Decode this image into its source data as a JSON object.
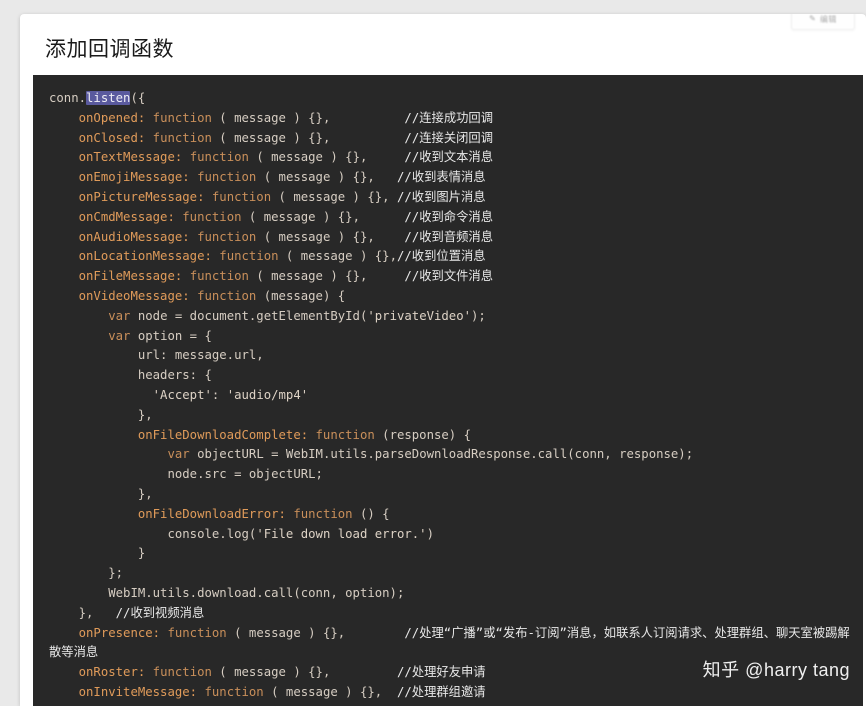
{
  "window": {
    "background_color": "#e9e9e9",
    "card_color": "#ffffff"
  },
  "header": {
    "title": "添加回调函数",
    "top_right_control": {
      "icon": "pencil-icon",
      "label": "编辑"
    }
  },
  "code_block": {
    "background_color": "#282828",
    "language": "javascript",
    "selection": {
      "text": "listen",
      "color": "#5a5a9e"
    },
    "lines": [
      {
        "indent": 0,
        "tokens": [
          {
            "t": "conn.",
            "c": "t-plain"
          },
          {
            "t": "listen",
            "c": "sel"
          },
          {
            "t": "({",
            "c": "t-punct"
          }
        ]
      },
      {
        "indent": 1,
        "tokens": [
          {
            "t": "onOpened: ",
            "c": "t-prop"
          },
          {
            "t": "function",
            "c": "t-kw"
          },
          {
            "t": " ( message ) {},",
            "c": "t-plain"
          },
          {
            "t": "          ",
            "c": "t-plain"
          },
          {
            "t": "//连接成功回调",
            "c": "t-cmt"
          }
        ]
      },
      {
        "indent": 1,
        "tokens": [
          {
            "t": "onClosed: ",
            "c": "t-prop"
          },
          {
            "t": "function",
            "c": "t-kw"
          },
          {
            "t": " ( message ) {},",
            "c": "t-plain"
          },
          {
            "t": "          ",
            "c": "t-plain"
          },
          {
            "t": "//连接关闭回调",
            "c": "t-cmt"
          }
        ]
      },
      {
        "indent": 1,
        "tokens": [
          {
            "t": "onTextMessage: ",
            "c": "t-prop"
          },
          {
            "t": "function",
            "c": "t-kw"
          },
          {
            "t": " ( message ) {},",
            "c": "t-plain"
          },
          {
            "t": "     ",
            "c": "t-plain"
          },
          {
            "t": "//收到文本消息",
            "c": "t-cmt"
          }
        ]
      },
      {
        "indent": 1,
        "tokens": [
          {
            "t": "onEmojiMessage: ",
            "c": "t-prop"
          },
          {
            "t": "function",
            "c": "t-kw"
          },
          {
            "t": " ( message ) {},",
            "c": "t-plain"
          },
          {
            "t": "   ",
            "c": "t-plain"
          },
          {
            "t": "//收到表情消息",
            "c": "t-cmt"
          }
        ]
      },
      {
        "indent": 1,
        "tokens": [
          {
            "t": "onPictureMessage: ",
            "c": "t-prop"
          },
          {
            "t": "function",
            "c": "t-kw"
          },
          {
            "t": " ( message ) {}, ",
            "c": "t-plain"
          },
          {
            "t": "//收到图片消息",
            "c": "t-cmt"
          }
        ]
      },
      {
        "indent": 1,
        "tokens": [
          {
            "t": "onCmdMessage: ",
            "c": "t-prop"
          },
          {
            "t": "function",
            "c": "t-kw"
          },
          {
            "t": " ( message ) {},",
            "c": "t-plain"
          },
          {
            "t": "      ",
            "c": "t-plain"
          },
          {
            "t": "//收到命令消息",
            "c": "t-cmt"
          }
        ]
      },
      {
        "indent": 1,
        "tokens": [
          {
            "t": "onAudioMessage: ",
            "c": "t-prop"
          },
          {
            "t": "function",
            "c": "t-kw"
          },
          {
            "t": " ( message ) {},",
            "c": "t-plain"
          },
          {
            "t": "    ",
            "c": "t-plain"
          },
          {
            "t": "//收到音频消息",
            "c": "t-cmt"
          }
        ]
      },
      {
        "indent": 1,
        "tokens": [
          {
            "t": "onLocationMessage: ",
            "c": "t-prop"
          },
          {
            "t": "function",
            "c": "t-kw"
          },
          {
            "t": " ( message ) {},",
            "c": "t-plain"
          },
          {
            "t": "//收到位置消息",
            "c": "t-cmt"
          }
        ]
      },
      {
        "indent": 1,
        "tokens": [
          {
            "t": "onFileMessage: ",
            "c": "t-prop"
          },
          {
            "t": "function",
            "c": "t-kw"
          },
          {
            "t": " ( message ) {},",
            "c": "t-plain"
          },
          {
            "t": "     ",
            "c": "t-plain"
          },
          {
            "t": "//收到文件消息",
            "c": "t-cmt"
          }
        ]
      },
      {
        "indent": 1,
        "tokens": [
          {
            "t": "onVideoMessage: ",
            "c": "t-prop"
          },
          {
            "t": "function",
            "c": "t-kw"
          },
          {
            "t": " (message) {",
            "c": "t-plain"
          }
        ]
      },
      {
        "indent": 2,
        "tokens": [
          {
            "t": "var",
            "c": "t-kw"
          },
          {
            "t": " node = document.getElementById(",
            "c": "t-plain"
          },
          {
            "t": "'privateVideo'",
            "c": "t-str"
          },
          {
            "t": ");",
            "c": "t-plain"
          }
        ]
      },
      {
        "indent": 2,
        "tokens": [
          {
            "t": "var",
            "c": "t-kw"
          },
          {
            "t": " option = {",
            "c": "t-plain"
          }
        ]
      },
      {
        "indent": 3,
        "tokens": [
          {
            "t": "url: message.url,",
            "c": "t-plain"
          }
        ]
      },
      {
        "indent": 3,
        "tokens": [
          {
            "t": "headers: {",
            "c": "t-plain"
          }
        ]
      },
      {
        "indent": 3,
        "extra": 2,
        "tokens": [
          {
            "t": "'Accept'",
            "c": "t-str"
          },
          {
            "t": ": ",
            "c": "t-plain"
          },
          {
            "t": "'audio/mp4'",
            "c": "t-str"
          }
        ]
      },
      {
        "indent": 3,
        "tokens": [
          {
            "t": "},",
            "c": "t-plain"
          }
        ]
      },
      {
        "indent": 3,
        "tokens": [
          {
            "t": "onFileDownloadComplete: ",
            "c": "t-prop"
          },
          {
            "t": "function",
            "c": "t-kw"
          },
          {
            "t": " (response) {",
            "c": "t-plain"
          }
        ]
      },
      {
        "indent": 4,
        "tokens": [
          {
            "t": "var",
            "c": "t-kw"
          },
          {
            "t": " objectURL = WebIM.utils.parseDownloadResponse.call(conn, response);",
            "c": "t-plain"
          }
        ]
      },
      {
        "indent": 4,
        "tokens": [
          {
            "t": "node.src = objectURL;",
            "c": "t-plain"
          }
        ]
      },
      {
        "indent": 3,
        "tokens": [
          {
            "t": "},",
            "c": "t-plain"
          }
        ]
      },
      {
        "indent": 3,
        "tokens": [
          {
            "t": "onFileDownloadError: ",
            "c": "t-prop"
          },
          {
            "t": "function",
            "c": "t-kw"
          },
          {
            "t": " () {",
            "c": "t-plain"
          }
        ]
      },
      {
        "indent": 4,
        "tokens": [
          {
            "t": "console.log(",
            "c": "t-plain"
          },
          {
            "t": "'File down load error.'",
            "c": "t-str"
          },
          {
            "t": ")",
            "c": "t-plain"
          }
        ]
      },
      {
        "indent": 3,
        "tokens": [
          {
            "t": "}",
            "c": "t-plain"
          }
        ]
      },
      {
        "indent": 2,
        "tokens": [
          {
            "t": "};",
            "c": "t-plain"
          }
        ]
      },
      {
        "indent": 2,
        "tokens": [
          {
            "t": "WebIM.utils.download.call(conn, option);",
            "c": "t-plain"
          }
        ]
      },
      {
        "indent": 1,
        "tokens": [
          {
            "t": "},   ",
            "c": "t-plain"
          },
          {
            "t": "//收到视频消息",
            "c": "t-cmt"
          }
        ]
      },
      {
        "indent": 1,
        "tokens": [
          {
            "t": "onPresence: ",
            "c": "t-prop"
          },
          {
            "t": "function",
            "c": "t-kw"
          },
          {
            "t": " ( message ) {},",
            "c": "t-plain"
          },
          {
            "t": "        ",
            "c": "t-plain"
          },
          {
            "t": "//处理“广播”或“发布-订阅”消息，如联系人订阅请求、处理群组、聊天室被踢解散等消息",
            "c": "t-cmt"
          }
        ]
      },
      {
        "indent": 1,
        "tokens": [
          {
            "t": "onRoster: ",
            "c": "t-prop"
          },
          {
            "t": "function",
            "c": "t-kw"
          },
          {
            "t": " ( message ) {},",
            "c": "t-plain"
          },
          {
            "t": "         ",
            "c": "t-plain"
          },
          {
            "t": "//处理好友申请",
            "c": "t-cmt"
          }
        ]
      },
      {
        "indent": 1,
        "tokens": [
          {
            "t": "onInviteMessage: ",
            "c": "t-prop"
          },
          {
            "t": "function",
            "c": "t-kw"
          },
          {
            "t": " ( message ) {},  ",
            "c": "t-plain"
          },
          {
            "t": "//处理群组邀请",
            "c": "t-cmt"
          }
        ]
      }
    ]
  },
  "watermark": {
    "text": "知乎 @harry tang"
  }
}
